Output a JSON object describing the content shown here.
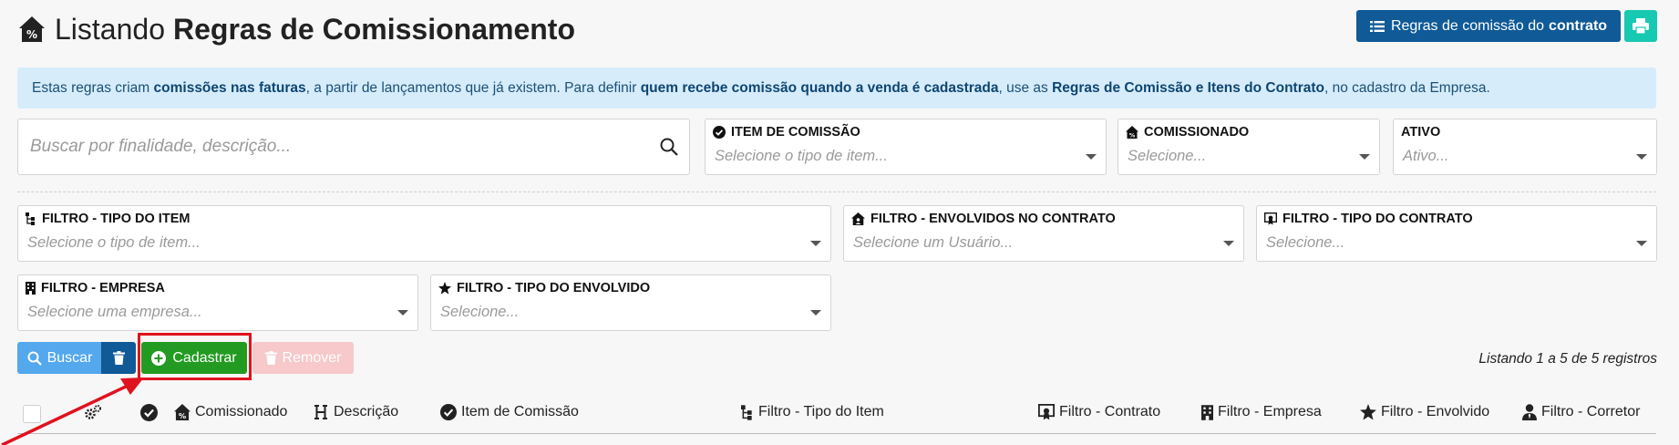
{
  "header": {
    "title_prefix": "Listando",
    "title_bold": "Regras de Comissionamento",
    "rules_button_prefix": "Regras de comissão do",
    "rules_button_bold": "contrato"
  },
  "info": {
    "t1": "Estas regras criam ",
    "b1": "comissões nas faturas",
    "t2": ", a partir de lançamentos que já existem. Para definir ",
    "b2": "quem recebe comissão quando a venda é cadastrada",
    "t3": ", use as ",
    "b3": "Regras de Comissão e Itens do Contrato",
    "t4": ", no cadastro da Empresa."
  },
  "filters": {
    "search_placeholder": "Buscar por finalidade, descrição...",
    "item_comissao": {
      "label": "ITEM DE COMISSÃO",
      "placeholder": "Selecione o tipo de item..."
    },
    "comissionado": {
      "label": "COMISSIONADO",
      "placeholder": "Selecione..."
    },
    "ativo": {
      "label": "ATIVO",
      "placeholder": "Ativo..."
    },
    "tipo_item": {
      "label": "FILTRO - TIPO DO ITEM",
      "placeholder": "Selecione o tipo de item..."
    },
    "envolvidos": {
      "label": "FILTRO - ENVOLVIDOS NO CONTRATO",
      "placeholder": "Selecione um Usuário..."
    },
    "tipo_contrato": {
      "label": "FILTRO - TIPO DO CONTRATO",
      "placeholder": "Selecione..."
    },
    "empresa": {
      "label": "FILTRO - EMPRESA",
      "placeholder": "Selecione uma empresa..."
    },
    "tipo_envolvido": {
      "label": "FILTRO - TIPO DO ENVOLVIDO",
      "placeholder": "Selecione..."
    }
  },
  "actions": {
    "buscar": "Buscar",
    "cadastrar": "Cadastrar",
    "remover": "Remover",
    "count": "Listando 1 a 5 de 5 registros"
  },
  "table": {
    "columns": {
      "comissionado": "Comissionado",
      "descricao": "Descrição",
      "item": "Item de Comissão",
      "tipo_item": "Filtro - Tipo do Item",
      "contrato": "Filtro - Contrato",
      "empresa": "Filtro - Empresa",
      "envolvido": "Filtro - Envolvido",
      "corretor": "Filtro - Corretor"
    }
  },
  "colors": {
    "primary": "#0f5a97",
    "info_bg": "#d6ecfb",
    "success": "#239b22",
    "danger_light": "#f7c9cb",
    "teal": "#17c9b0",
    "highlight": "#e0121e"
  }
}
